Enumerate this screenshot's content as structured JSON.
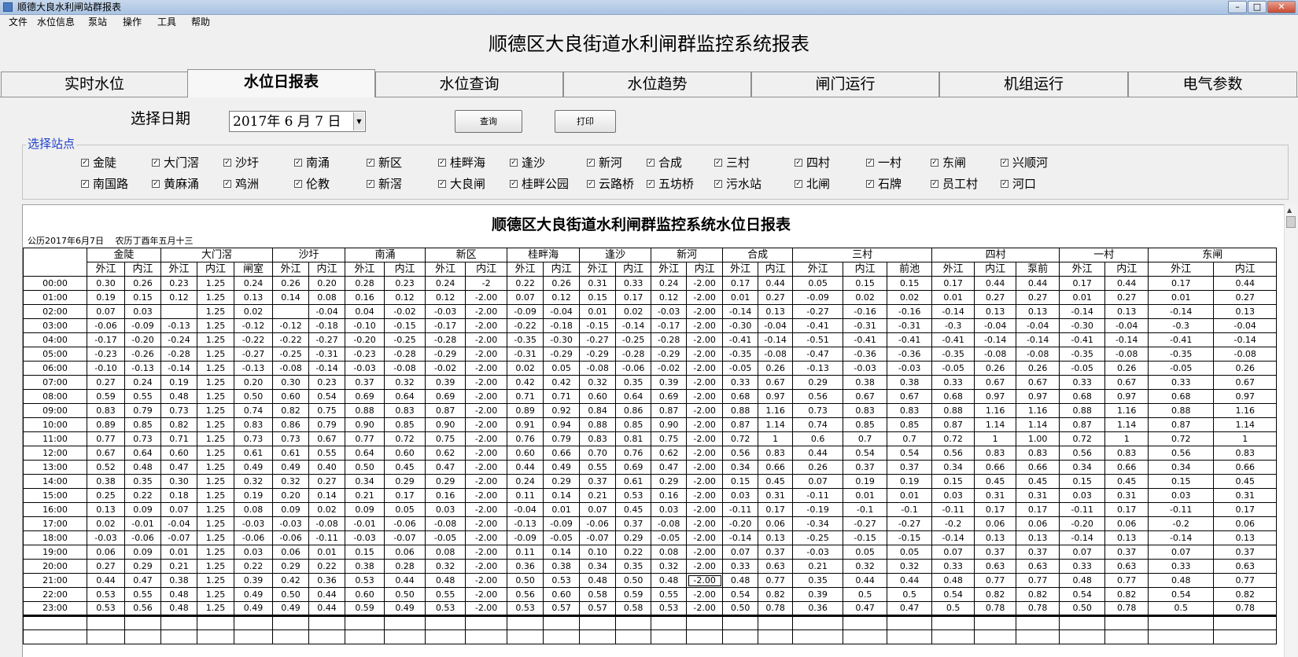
{
  "window": {
    "title": "顺德大良水利闸站群报表",
    "btn_min": "–",
    "btn_max": "□",
    "btn_close": "✕"
  },
  "menu": [
    "文件",
    "水位信息",
    "泵站",
    "操作",
    "工具",
    "帮助"
  ],
  "main_title": "顺德区大良街道水利闸群监控系统报表",
  "tabs": [
    "实时水位",
    "水位日报表",
    "水位查询",
    "水位趋势",
    "闸门运行",
    "机组运行",
    "电气参数"
  ],
  "active_tab": 1,
  "query": {
    "date_label": "选择日期",
    "date_value": "2017年 6 月 7 日",
    "query_btn": "查询",
    "print_btn": "打印"
  },
  "stations": {
    "legend": "选择站点",
    "check_mark": "✓",
    "row1": [
      "金陡",
      "大门滘",
      "沙圩",
      "南涌",
      "新区",
      "桂畔海",
      "逢沙",
      "新河",
      "合成",
      "三村",
      "四村",
      "一村",
      "东闸",
      "兴顺河"
    ],
    "row2": [
      "南国路",
      "黄麻涌",
      "鸡洲",
      "伦教",
      "新滘",
      "大良闸",
      "桂畔公园",
      "云路桥",
      "五坊桥",
      "污水站",
      "北闸",
      "石牌",
      "员工村",
      "河口"
    ]
  },
  "report": {
    "title": "顺德区大良街道水利闸群监控系统水位日报表",
    "date_line": "公历2017年6月7日　 农历丁酉年五月十三",
    "groups": [
      {
        "name": "金陡",
        "cols": [
          "外江",
          "内江"
        ]
      },
      {
        "name": "大门滘",
        "cols": [
          "外江",
          "内江",
          "闸室"
        ]
      },
      {
        "name": "沙圩",
        "cols": [
          "外江",
          "内江"
        ]
      },
      {
        "name": "南涌",
        "cols": [
          "外江",
          "内江"
        ]
      },
      {
        "name": "新区",
        "cols": [
          "外江",
          "内江"
        ]
      },
      {
        "name": "桂畔海",
        "cols": [
          "外江",
          "内江"
        ]
      },
      {
        "name": "逢沙",
        "cols": [
          "外江",
          "内江"
        ]
      },
      {
        "name": "新河",
        "cols": [
          "外江",
          "内江"
        ]
      },
      {
        "name": "合成",
        "cols": [
          "外江",
          "内江"
        ]
      },
      {
        "name": "三村",
        "cols": [
          "外江",
          "内江",
          "前池"
        ]
      },
      {
        "name": "四村",
        "cols": [
          "外江",
          "内江",
          "泵前"
        ]
      },
      {
        "name": "一村",
        "cols": [
          "外江",
          "内江"
        ]
      },
      {
        "name": "东闸",
        "cols": [
          "外江",
          "内江"
        ]
      }
    ],
    "rows": [
      {
        "time": "00:00",
        "v": [
          "0.30",
          "0.26",
          "0.23",
          "1.25",
          "0.24",
          "0.26",
          "0.20",
          "0.28",
          "0.23",
          "0.24",
          "-2",
          "0.22",
          "0.26",
          "0.31",
          "0.33",
          "0.24",
          "-2.00",
          "0.17",
          "0.44",
          "0.05",
          "0.15",
          "0.15",
          "0.17",
          "0.44",
          "0.44",
          "0.17",
          "0.44",
          "0.17",
          "0.44"
        ]
      },
      {
        "time": "01:00",
        "v": [
          "0.19",
          "0.15",
          "0.12",
          "1.25",
          "0.13",
          "0.14",
          "0.08",
          "0.16",
          "0.12",
          "0.12",
          "-2.00",
          "0.07",
          "0.12",
          "0.15",
          "0.17",
          "0.12",
          "-2.00",
          "0.01",
          "0.27",
          "-0.09",
          "0.02",
          "0.02",
          "0.01",
          "0.27",
          "0.27",
          "0.01",
          "0.27",
          "0.01",
          "0.27"
        ]
      },
      {
        "time": "02:00",
        "v": [
          "0.07",
          "0.03",
          "",
          "1.25",
          "0.02",
          "",
          "-0.04",
          "0.04",
          "-0.02",
          "-0.03",
          "-2.00",
          "-0.09",
          "-0.04",
          "0.01",
          "0.02",
          "-0.03",
          "-2.00",
          "-0.14",
          "0.13",
          "-0.27",
          "-0.16",
          "-0.16",
          "-0.14",
          "0.13",
          "0.13",
          "-0.14",
          "0.13",
          "-0.14",
          "0.13"
        ]
      },
      {
        "time": "03:00",
        "v": [
          "-0.06",
          "-0.09",
          "-0.13",
          "1.25",
          "-0.12",
          "-0.12",
          "-0.18",
          "-0.10",
          "-0.15",
          "-0.17",
          "-2.00",
          "-0.22",
          "-0.18",
          "-0.15",
          "-0.14",
          "-0.17",
          "-2.00",
          "-0.30",
          "-0.04",
          "-0.41",
          "-0.31",
          "-0.31",
          "-0.3",
          "-0.04",
          "-0.04",
          "-0.30",
          "-0.04",
          "-0.3",
          "-0.04"
        ]
      },
      {
        "time": "04:00",
        "v": [
          "-0.17",
          "-0.20",
          "-0.24",
          "1.25",
          "-0.22",
          "-0.22",
          "-0.27",
          "-0.20",
          "-0.25",
          "-0.28",
          "-2.00",
          "-0.35",
          "-0.30",
          "-0.27",
          "-0.25",
          "-0.28",
          "-2.00",
          "-0.41",
          "-0.14",
          "-0.51",
          "-0.41",
          "-0.41",
          "-0.41",
          "-0.14",
          "-0.14",
          "-0.41",
          "-0.14",
          "-0.41",
          "-0.14"
        ]
      },
      {
        "time": "05:00",
        "v": [
          "-0.23",
          "-0.26",
          "-0.28",
          "1.25",
          "-0.27",
          "-0.25",
          "-0.31",
          "-0.23",
          "-0.28",
          "-0.29",
          "-2.00",
          "-0.31",
          "-0.29",
          "-0.29",
          "-0.28",
          "-0.29",
          "-2.00",
          "-0.35",
          "-0.08",
          "-0.47",
          "-0.36",
          "-0.36",
          "-0.35",
          "-0.08",
          "-0.08",
          "-0.35",
          "-0.08",
          "-0.35",
          "-0.08"
        ]
      },
      {
        "time": "06:00",
        "v": [
          "-0.10",
          "-0.13",
          "-0.14",
          "1.25",
          "-0.13",
          "-0.08",
          "-0.14",
          "-0.03",
          "-0.08",
          "-0.02",
          "-2.00",
          "0.02",
          "0.05",
          "-0.08",
          "-0.06",
          "-0.02",
          "-2.00",
          "-0.05",
          "0.26",
          "-0.13",
          "-0.03",
          "-0.03",
          "-0.05",
          "0.26",
          "0.26",
          "-0.05",
          "0.26",
          "-0.05",
          "0.26"
        ]
      },
      {
        "time": "07:00",
        "v": [
          "0.27",
          "0.24",
          "0.19",
          "1.25",
          "0.20",
          "0.30",
          "0.23",
          "0.37",
          "0.32",
          "0.39",
          "-2.00",
          "0.42",
          "0.42",
          "0.32",
          "0.35",
          "0.39",
          "-2.00",
          "0.33",
          "0.67",
          "0.29",
          "0.38",
          "0.38",
          "0.33",
          "0.67",
          "0.67",
          "0.33",
          "0.67",
          "0.33",
          "0.67"
        ]
      },
      {
        "time": "08:00",
        "v": [
          "0.59",
          "0.55",
          "0.48",
          "1.25",
          "0.50",
          "0.60",
          "0.54",
          "0.69",
          "0.64",
          "0.69",
          "-2.00",
          "0.71",
          "0.71",
          "0.60",
          "0.64",
          "0.69",
          "-2.00",
          "0.68",
          "0.97",
          "0.56",
          "0.67",
          "0.67",
          "0.68",
          "0.97",
          "0.97",
          "0.68",
          "0.97",
          "0.68",
          "0.97"
        ]
      },
      {
        "time": "09:00",
        "v": [
          "0.83",
          "0.79",
          "0.73",
          "1.25",
          "0.74",
          "0.82",
          "0.75",
          "0.88",
          "0.83",
          "0.87",
          "-2.00",
          "0.89",
          "0.92",
          "0.84",
          "0.86",
          "0.87",
          "-2.00",
          "0.88",
          "1.16",
          "0.73",
          "0.83",
          "0.83",
          "0.88",
          "1.16",
          "1.16",
          "0.88",
          "1.16",
          "0.88",
          "1.16"
        ]
      },
      {
        "time": "10:00",
        "v": [
          "0.89",
          "0.85",
          "0.82",
          "1.25",
          "0.83",
          "0.86",
          "0.79",
          "0.90",
          "0.85",
          "0.90",
          "-2.00",
          "0.91",
          "0.94",
          "0.88",
          "0.85",
          "0.90",
          "-2.00",
          "0.87",
          "1.14",
          "0.74",
          "0.85",
          "0.85",
          "0.87",
          "1.14",
          "1.14",
          "0.87",
          "1.14",
          "0.87",
          "1.14"
        ]
      },
      {
        "time": "11:00",
        "v": [
          "0.77",
          "0.73",
          "0.71",
          "1.25",
          "0.73",
          "0.73",
          "0.67",
          "0.77",
          "0.72",
          "0.75",
          "-2.00",
          "0.76",
          "0.79",
          "0.83",
          "0.81",
          "0.75",
          "-2.00",
          "0.72",
          "1",
          "0.6",
          "0.7",
          "0.7",
          "0.72",
          "1",
          "1.00",
          "0.72",
          "1",
          "0.72",
          "1"
        ]
      },
      {
        "time": "12:00",
        "v": [
          "0.67",
          "0.64",
          "0.60",
          "1.25",
          "0.61",
          "0.61",
          "0.55",
          "0.64",
          "0.60",
          "0.62",
          "-2.00",
          "0.60",
          "0.66",
          "0.70",
          "0.76",
          "0.62",
          "-2.00",
          "0.56",
          "0.83",
          "0.44",
          "0.54",
          "0.54",
          "0.56",
          "0.83",
          "0.83",
          "0.56",
          "0.83",
          "0.56",
          "0.83"
        ]
      },
      {
        "time": "13:00",
        "v": [
          "0.52",
          "0.48",
          "0.47",
          "1.25",
          "0.49",
          "0.49",
          "0.40",
          "0.50",
          "0.45",
          "0.47",
          "-2.00",
          "0.44",
          "0.49",
          "0.55",
          "0.69",
          "0.47",
          "-2.00",
          "0.34",
          "0.66",
          "0.26",
          "0.37",
          "0.37",
          "0.34",
          "0.66",
          "0.66",
          "0.34",
          "0.66",
          "0.34",
          "0.66"
        ]
      },
      {
        "time": "14:00",
        "v": [
          "0.38",
          "0.35",
          "0.30",
          "1.25",
          "0.32",
          "0.32",
          "0.27",
          "0.34",
          "0.29",
          "0.29",
          "-2.00",
          "0.24",
          "0.29",
          "0.37",
          "0.61",
          "0.29",
          "-2.00",
          "0.15",
          "0.45",
          "0.07",
          "0.19",
          "0.19",
          "0.15",
          "0.45",
          "0.45",
          "0.15",
          "0.45",
          "0.15",
          "0.45"
        ]
      },
      {
        "time": "15:00",
        "v": [
          "0.25",
          "0.22",
          "0.18",
          "1.25",
          "0.19",
          "0.20",
          "0.14",
          "0.21",
          "0.17",
          "0.16",
          "-2.00",
          "0.11",
          "0.14",
          "0.21",
          "0.53",
          "0.16",
          "-2.00",
          "0.03",
          "0.31",
          "-0.11",
          "0.01",
          "0.01",
          "0.03",
          "0.31",
          "0.31",
          "0.03",
          "0.31",
          "0.03",
          "0.31"
        ]
      },
      {
        "time": "16:00",
        "v": [
          "0.13",
          "0.09",
          "0.07",
          "1.25",
          "0.08",
          "0.09",
          "0.02",
          "0.09",
          "0.05",
          "0.03",
          "-2.00",
          "-0.04",
          "0.01",
          "0.07",
          "0.45",
          "0.03",
          "-2.00",
          "-0.11",
          "0.17",
          "-0.19",
          "-0.1",
          "-0.1",
          "-0.11",
          "0.17",
          "0.17",
          "-0.11",
          "0.17",
          "-0.11",
          "0.17"
        ]
      },
      {
        "time": "17:00",
        "v": [
          "0.02",
          "-0.01",
          "-0.04",
          "1.25",
          "-0.03",
          "-0.03",
          "-0.08",
          "-0.01",
          "-0.06",
          "-0.08",
          "-2.00",
          "-0.13",
          "-0.09",
          "-0.06",
          "0.37",
          "-0.08",
          "-2.00",
          "-0.20",
          "0.06",
          "-0.34",
          "-0.27",
          "-0.27",
          "-0.2",
          "0.06",
          "0.06",
          "-0.20",
          "0.06",
          "-0.2",
          "0.06"
        ]
      },
      {
        "time": "18:00",
        "v": [
          "-0.03",
          "-0.06",
          "-0.07",
          "1.25",
          "-0.06",
          "-0.06",
          "-0.11",
          "-0.03",
          "-0.07",
          "-0.05",
          "-2.00",
          "-0.09",
          "-0.05",
          "-0.07",
          "0.29",
          "-0.05",
          "-2.00",
          "-0.14",
          "0.13",
          "-0.25",
          "-0.15",
          "-0.15",
          "-0.14",
          "0.13",
          "0.13",
          "-0.14",
          "0.13",
          "-0.14",
          "0.13"
        ]
      },
      {
        "time": "19:00",
        "v": [
          "0.06",
          "0.09",
          "0.01",
          "1.25",
          "0.03",
          "0.06",
          "0.01",
          "0.15",
          "0.06",
          "0.08",
          "-2.00",
          "0.11",
          "0.14",
          "0.10",
          "0.22",
          "0.08",
          "-2.00",
          "0.07",
          "0.37",
          "-0.03",
          "0.05",
          "0.05",
          "0.07",
          "0.37",
          "0.37",
          "0.07",
          "0.37",
          "0.07",
          "0.37"
        ]
      },
      {
        "time": "20:00",
        "v": [
          "0.27",
          "0.29",
          "0.21",
          "1.25",
          "0.22",
          "0.29",
          "0.22",
          "0.38",
          "0.28",
          "0.32",
          "-2.00",
          "0.36",
          "0.38",
          "0.34",
          "0.35",
          "0.32",
          "-2.00",
          "0.33",
          "0.63",
          "0.21",
          "0.32",
          "0.32",
          "0.33",
          "0.63",
          "0.63",
          "0.33",
          "0.63",
          "0.33",
          "0.63"
        ]
      },
      {
        "time": "21:00",
        "v": [
          "0.44",
          "0.47",
          "0.38",
          "1.25",
          "0.39",
          "0.42",
          "0.36",
          "0.53",
          "0.44",
          "0.48",
          "-2.00",
          "0.50",
          "0.53",
          "0.48",
          "0.50",
          "0.48",
          "-2.00",
          "0.48",
          "0.77",
          "0.35",
          "0.44",
          "0.44",
          "0.48",
          "0.77",
          "0.77",
          "0.48",
          "0.77",
          "0.48",
          "0.77"
        ]
      },
      {
        "time": "22:00",
        "v": [
          "0.53",
          "0.55",
          "0.48",
          "1.25",
          "0.49",
          "0.50",
          "0.44",
          "0.60",
          "0.50",
          "0.55",
          "-2.00",
          "0.56",
          "0.60",
          "0.58",
          "0.59",
          "0.55",
          "-2.00",
          "0.54",
          "0.82",
          "0.39",
          "0.5",
          "0.5",
          "0.54",
          "0.82",
          "0.82",
          "0.54",
          "0.82",
          "0.54",
          "0.82"
        ]
      },
      {
        "time": "23:00",
        "v": [
          "0.53",
          "0.56",
          "0.48",
          "1.25",
          "0.49",
          "0.49",
          "0.44",
          "0.59",
          "0.49",
          "0.53",
          "-2.00",
          "0.53",
          "0.57",
          "0.57",
          "0.58",
          "0.53",
          "-2.00",
          "0.50",
          "0.78",
          "0.36",
          "0.47",
          "0.47",
          "0.5",
          "0.78",
          "0.78",
          "0.50",
          "0.78",
          "0.5",
          "0.78"
        ]
      }
    ],
    "blank_rows": 2
  }
}
